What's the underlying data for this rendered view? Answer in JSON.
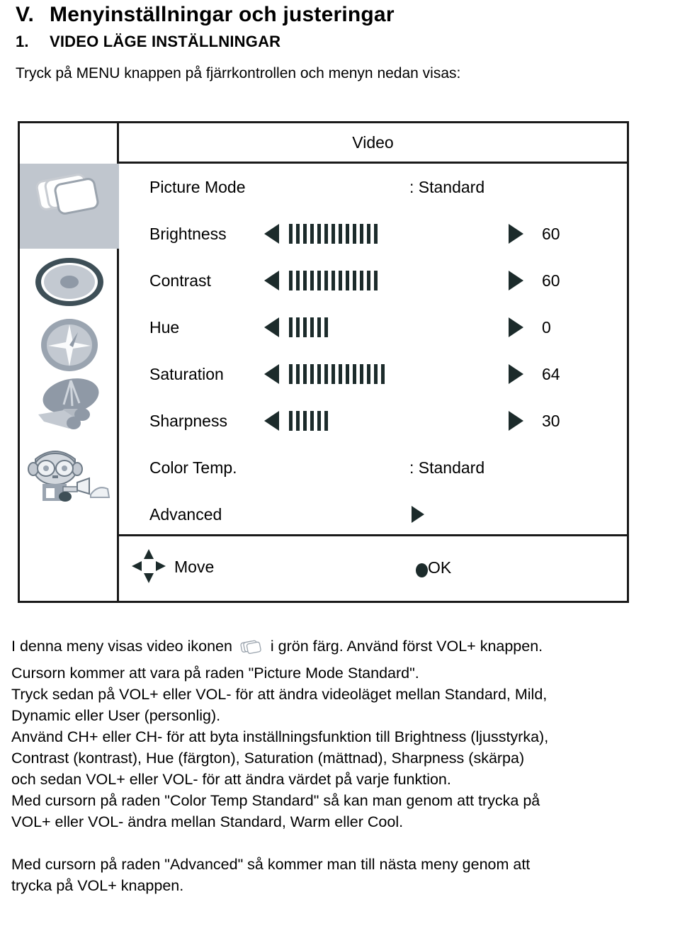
{
  "headings": {
    "main_numeral": "V.",
    "main_text": "Menyinställningar och justeringar",
    "sub_numeral": "1.",
    "sub_text": "VIDEO LÄGE INSTÄLLNINGAR",
    "intro": "Tryck på MENU knappen på fjärrkontrollen och menyn nedan visas:"
  },
  "osd": {
    "title": "Video",
    "sidebar_icons": [
      {
        "name": "picture-mode-icon",
        "label": "picture-frames"
      },
      {
        "name": "contrast-disc-icon",
        "label": "disc"
      },
      {
        "name": "hue-compass-icon",
        "label": "compass"
      },
      {
        "name": "saturation-dish-icon",
        "label": "satellite-dish"
      },
      {
        "name": "sharpness-person-icon",
        "label": "person-camera"
      }
    ],
    "rows": [
      {
        "label": "Picture Mode",
        "type": "text",
        "value": ": Standard"
      },
      {
        "label": "Brightness",
        "type": "slider",
        "bars": 13,
        "value": "60"
      },
      {
        "label": "Contrast",
        "type": "slider",
        "bars": 13,
        "value": "60"
      },
      {
        "label": "Hue",
        "type": "slider",
        "bars": 6,
        "value": "0"
      },
      {
        "label": "Saturation",
        "type": "slider",
        "bars": 14,
        "value": "64"
      },
      {
        "label": "Sharpness",
        "type": "slider",
        "bars": 6,
        "value": "30"
      },
      {
        "label": "Color Temp.",
        "type": "text",
        "value": ": Standard"
      },
      {
        "label": "Advanced",
        "type": "submenu",
        "value": ""
      }
    ],
    "footer": {
      "move_label": "Move",
      "ok_label": "OK"
    }
  },
  "prose": {
    "lines": [
      "I denna meny visas video ikonen @ICON@ i grön färg. Använd först VOL+ knappen.",
      "Cursorn kommer att vara på raden \"Picture Mode Standard\".",
      "Tryck sedan på VOL+ eller VOL- för att ändra videoläget mellan Standard, Mild,",
      "Dynamic eller User (personlig).",
      "Använd CH+ eller CH- för att byta inställningsfunktion till Brightness (ljusstyrka),",
      "Contrast (kontrast), Hue (färgton), Saturation (mättnad), Sharpness (skärpa)",
      "och sedan VOL+ eller VOL- för att ändra värdet på varje funktion.",
      "Med cursorn på raden \"Color Temp Standard\" så kan man genom att trycka på",
      "VOL+ eller VOL- ändra mellan Standard, Warm eller Cool.",
      "",
      "Med cursorn på raden \"Advanced\" så kommer man till nästa meny genom att",
      "trycka på VOL+ knappen."
    ]
  },
  "colors": {
    "border": "#1a1a1a",
    "highlight": "#c0c6ce",
    "ink": "#1c2b2b"
  }
}
